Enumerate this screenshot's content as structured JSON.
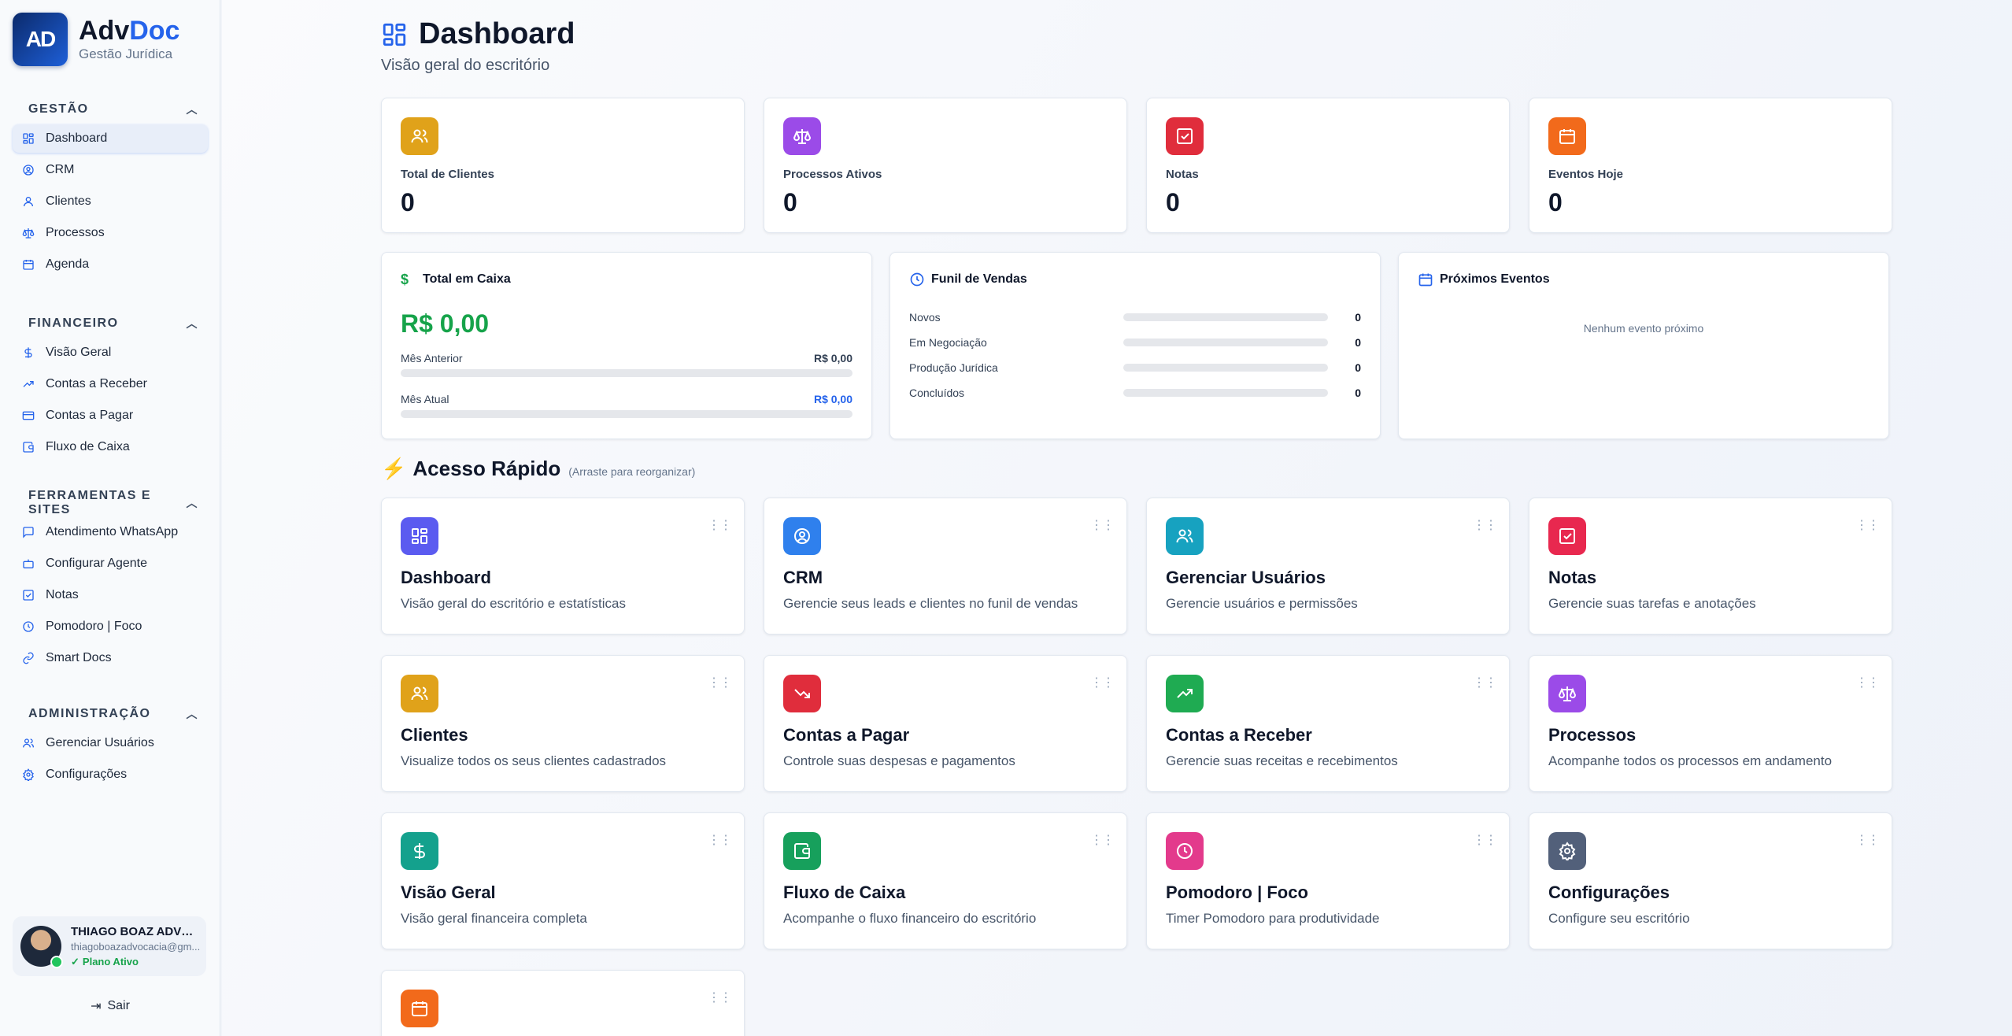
{
  "brand": {
    "logo": "AD",
    "name_a": "Adv",
    "name_b": "Doc",
    "subtitle": "Gestão Jurídica"
  },
  "sidebar": {
    "sections": [
      {
        "title": "GESTÃO",
        "items": [
          "Dashboard",
          "CRM",
          "Clientes",
          "Processos",
          "Agenda"
        ]
      },
      {
        "title": "FINANCEIRO",
        "items": [
          "Visão Geral",
          "Contas a Receber",
          "Contas a Pagar",
          "Fluxo de Caixa"
        ]
      },
      {
        "title": "FERRAMENTAS E SITES",
        "items": [
          "Atendimento WhatsApp",
          "Configurar Agente",
          "Notas",
          "Pomodoro | Foco",
          "Smart Docs"
        ]
      },
      {
        "title": "ADMINISTRAÇÃO",
        "items": [
          "Gerenciar Usuários",
          "Configurações"
        ]
      }
    ],
    "active_item": "Dashboard"
  },
  "user": {
    "name": "THIAGO BOAZ ADVOC...",
    "email": "thiagoboazadvocacia@gm...",
    "plan": "Plano Ativo"
  },
  "logout_label": "Sair",
  "page": {
    "title": "Dashboard",
    "subtitle": "Visão geral do escritório"
  },
  "stats": [
    {
      "label": "Total de Clientes",
      "value": "0",
      "color": "#e0a21a",
      "icon": "users-icon"
    },
    {
      "label": "Processos Ativos",
      "value": "0",
      "color": "#9b4be8",
      "icon": "scale-icon"
    },
    {
      "label": "Notas",
      "value": "0",
      "color": "#e02d3c",
      "icon": "check-square-icon"
    },
    {
      "label": "Eventos Hoje",
      "value": "0",
      "color": "#f26a1b",
      "icon": "calendar-icon"
    }
  ],
  "cash": {
    "title": "Total em Caixa",
    "value": "R$ 0,00",
    "prev_label": "Mês Anterior",
    "prev_value": "R$ 0,00",
    "curr_label": "Mês Atual",
    "curr_value": "R$ 0,00"
  },
  "funnel": {
    "title": "Funil de Vendas",
    "rows": [
      {
        "label": "Novos",
        "value": "0"
      },
      {
        "label": "Em Negociação",
        "value": "0"
      },
      {
        "label": "Produção Jurídica",
        "value": "0"
      },
      {
        "label": "Concluídos",
        "value": "0"
      }
    ]
  },
  "events": {
    "title": "Próximos Eventos",
    "empty": "Nenhum evento próximo"
  },
  "quick_access": {
    "title": "Acesso Rápido",
    "hint": "(Arraste para reorganizar)",
    "items": [
      {
        "name": "Dashboard",
        "desc": "Visão geral do escritório e estatísticas",
        "color": "#5b5bf0",
        "icon": "grid-icon"
      },
      {
        "name": "CRM",
        "desc": "Gerencie seus leads e clientes no funil de vendas",
        "color": "#2f80ed",
        "icon": "user-circle-icon"
      },
      {
        "name": "Gerenciar Usuários",
        "desc": "Gerencie usuários e permissões",
        "color": "#17a2c0",
        "icon": "users-icon"
      },
      {
        "name": "Notas",
        "desc": "Gerencie suas tarefas e anotações",
        "color": "#e8284f",
        "icon": "check-square-icon"
      },
      {
        "name": "Clientes",
        "desc": "Visualize todos os seus clientes cadastrados",
        "color": "#e0a21a",
        "icon": "users-icon"
      },
      {
        "name": "Contas a Pagar",
        "desc": "Controle suas despesas e pagamentos",
        "color": "#e02d3c",
        "icon": "trend-down-icon"
      },
      {
        "name": "Contas a Receber",
        "desc": "Gerencie suas receitas e recebimentos",
        "color": "#1fab52",
        "icon": "trend-up-icon"
      },
      {
        "name": "Processos",
        "desc": "Acompanhe todos os processos em andamento",
        "color": "#9b4be8",
        "icon": "scale-icon"
      },
      {
        "name": "Visão Geral",
        "desc": "Visão geral financeira completa",
        "color": "#14a18d",
        "icon": "dollar-icon"
      },
      {
        "name": "Fluxo de Caixa",
        "desc": "Acompanhe o fluxo financeiro do escritório",
        "color": "#17a05c",
        "icon": "wallet-icon"
      },
      {
        "name": "Pomodoro | Foco",
        "desc": "Timer Pomodoro para produtividade",
        "color": "#e33a8c",
        "icon": "clock-icon"
      },
      {
        "name": "Configurações",
        "desc": "Configure seu escritório",
        "color": "#52607a",
        "icon": "gear-icon"
      },
      {
        "name": "",
        "desc": "",
        "color": "#f26a1b",
        "icon": "calendar-icon"
      }
    ]
  }
}
